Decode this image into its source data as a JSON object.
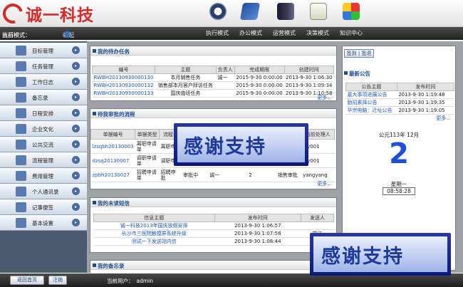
{
  "app": {
    "logo_text": "诚一科技"
  },
  "nav": {
    "modes": [
      {
        "label": "执行模式",
        "icon": "clock-icon"
      },
      {
        "label": "办公模式",
        "icon": "book-icon"
      },
      {
        "label": "运营模式",
        "icon": "binder-icon"
      },
      {
        "label": "决策模式",
        "icon": "checklist-icon"
      },
      {
        "label": "知识中心",
        "icon": "cubes-icon"
      }
    ],
    "current_mode_label": "当前模式：",
    "current_mode": "执行模式",
    "collapse_label": "收起"
  },
  "sidebar": {
    "items": [
      {
        "label": "目标管理"
      },
      {
        "label": "任务管理"
      },
      {
        "label": "工作日志"
      },
      {
        "label": "备忘录"
      },
      {
        "label": "日程安排"
      },
      {
        "label": "企业文化"
      },
      {
        "label": "公共交流"
      },
      {
        "label": "流程管理"
      },
      {
        "label": "费用管理"
      },
      {
        "label": "个人通讯录"
      },
      {
        "label": "记事便签"
      },
      {
        "label": "基本设置"
      }
    ]
  },
  "tasks": {
    "title": "我的待办任务",
    "headers": [
      "编号",
      "主题",
      "负责人",
      "完成期限",
      "创建时间"
    ],
    "rows": [
      [
        "RWBH20130930000130",
        "本月销售任务",
        "诚一",
        "2015-9-30 0:00:00",
        "2013-9-30 1:06:30"
      ],
      [
        "RWBH20130930000132",
        "销售部本月客户拜访任务",
        "",
        "2015-9-30 0:00:00",
        "2013-9-30 1:09:34"
      ],
      [
        "RWBH20130930000133",
        "国庆值班任务",
        "",
        "2015-9-30 0:00:00",
        "2013-9-30 1:10:58"
      ]
    ],
    "more": "更多..."
  },
  "approvals": {
    "title": "待我审批的流程",
    "headers": [
      "单据编号",
      "单据类型",
      "流程名",
      "",
      "",
      "",
      "当前处理人"
    ],
    "rows": [
      [
        "lzsqbh20130003",
        "离职申请单",
        "离职申",
        "",
        "",
        "",
        "lyy001"
      ],
      [
        "dzsq20130007",
        "调职申请单",
        "调职申",
        "",
        "",
        "",
        "lyy001"
      ],
      [
        "zpbh20130027",
        "招聘申请单",
        "招聘申批",
        "审批中",
        "诚一",
        "2",
        "销售审批",
        "yangyang"
      ]
    ],
    "more": "更多..."
  },
  "messages": {
    "title": "我的未读短信",
    "headers": [
      "信息主题",
      "发布时间",
      "发送人"
    ],
    "rows": [
      [
        "诚一科技2013年国庆放假安排",
        "2013-9-30 1:06:57",
        ""
      ],
      [
        "长沙市三医院触摸屏系统升级",
        "2013-9-30 1:07:58",
        "宋江"
      ],
      [
        "测试一下发送站内信",
        "2013-9-30 1:08:44",
        ""
      ]
    ],
    "more": "更多..."
  },
  "memo": {
    "title": "我的备忘录"
  },
  "right": {
    "signin_label": "签到 | 签退",
    "notices_title": "最新公告",
    "notices_headers": [
      "公告主题",
      "发布时间"
    ],
    "notices": [
      [
        "嘉大事项进展公告",
        "2013-9-30 1:19:48"
      ],
      [
        "励招素择公告",
        "2013-9-30 1:19:35"
      ],
      [
        "华宗电脑：迁址公告",
        "2013-9-30 1:19:05"
      ]
    ],
    "more": "更多...",
    "calendar_header": "公元113年 12月",
    "day": "2",
    "weekday": "星期一",
    "time": "08:58:28"
  },
  "bottom": {
    "home_button": "返回首页",
    "logout_button": "注销",
    "current_user_label": "当前用户：",
    "current_user": "admin"
  },
  "watermarks": [
    {
      "text": "感谢支持"
    },
    {
      "text": "感谢支持"
    }
  ],
  "colors": {
    "brand_red": "#d42a2a",
    "link_blue": "#1c57c4",
    "title_blue": "#1e4f91",
    "sidebar_slate": "#4a5a6e"
  }
}
